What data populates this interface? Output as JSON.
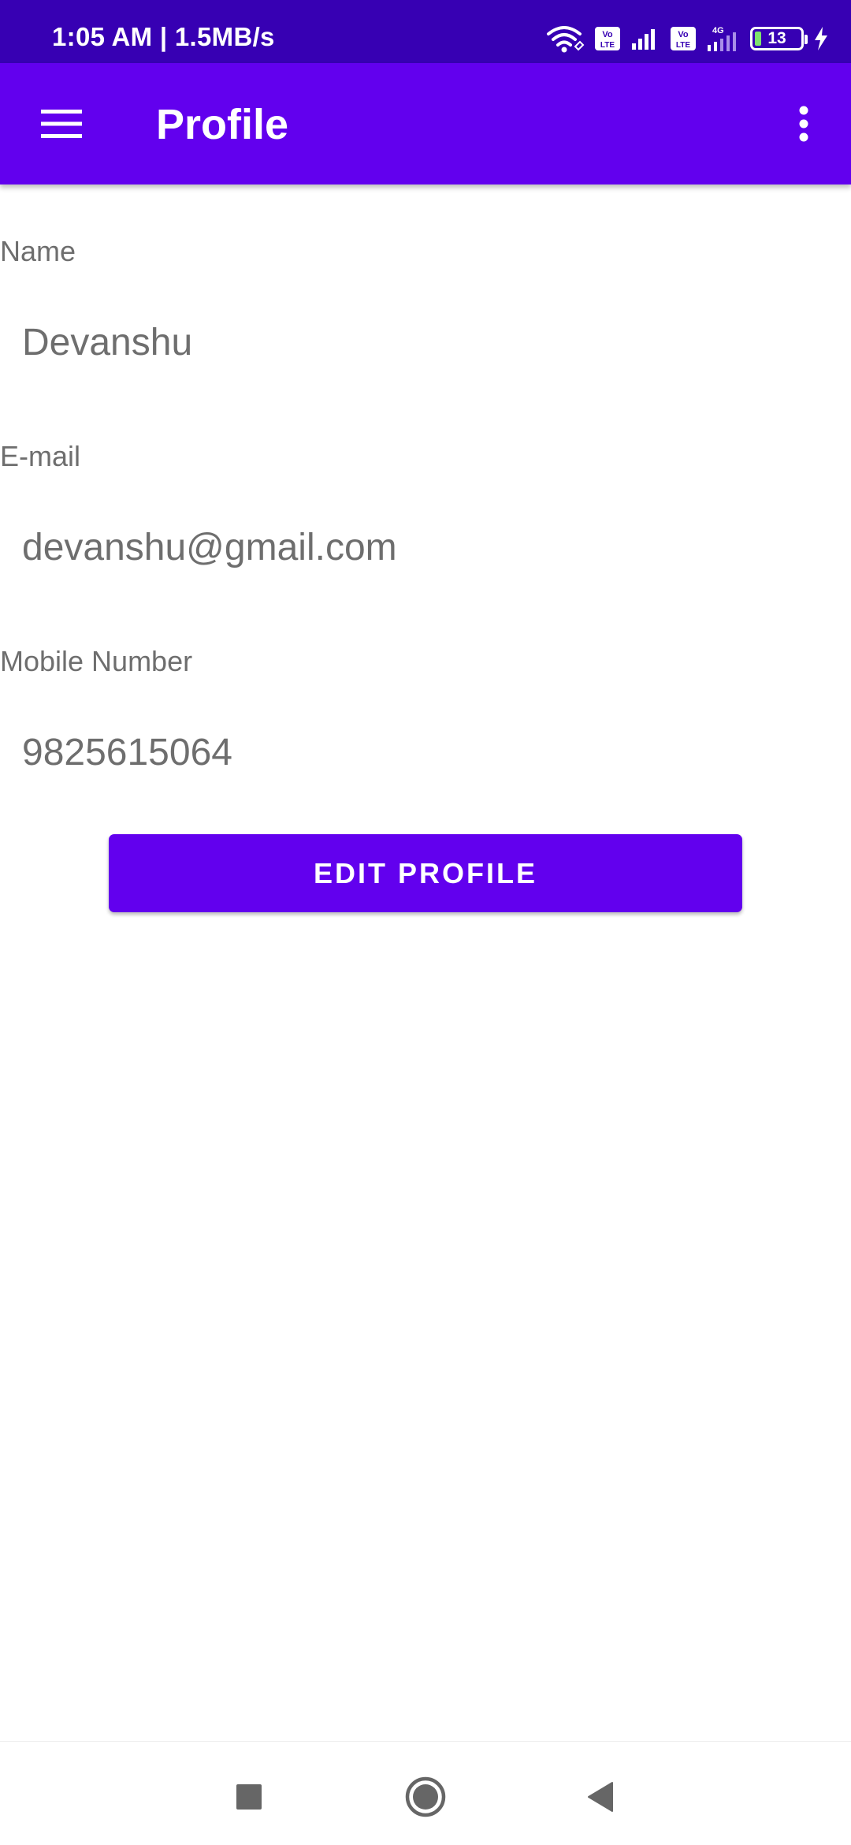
{
  "status_bar": {
    "time_speed": "1:05 AM | 1.5MB/s",
    "battery_level": "13",
    "icons": [
      "wifi-icon",
      "volte-icon",
      "signal-icon",
      "volte-icon",
      "4g-signal-icon",
      "battery-icon",
      "charging-icon"
    ]
  },
  "app_bar": {
    "title": "Profile",
    "menu_icon": "hamburger-menu-icon",
    "overflow_icon": "more-vert-icon"
  },
  "profile": {
    "name_label": "Name",
    "name_value": "Devanshu",
    "email_label": "E-mail",
    "email_value": "devanshu@gmail.com",
    "mobile_label": "Mobile Number",
    "mobile_value": "9825615064"
  },
  "actions": {
    "edit_label": "EDIT PROFILE"
  },
  "nav_bar": {
    "icons": [
      "recents-square-icon",
      "home-circle-icon",
      "back-triangle-icon"
    ]
  },
  "colors": {
    "status_bar": "#3700b3",
    "primary": "#6200ee",
    "text_secondary": "#6e6e6e",
    "nav_icon": "#666666"
  }
}
